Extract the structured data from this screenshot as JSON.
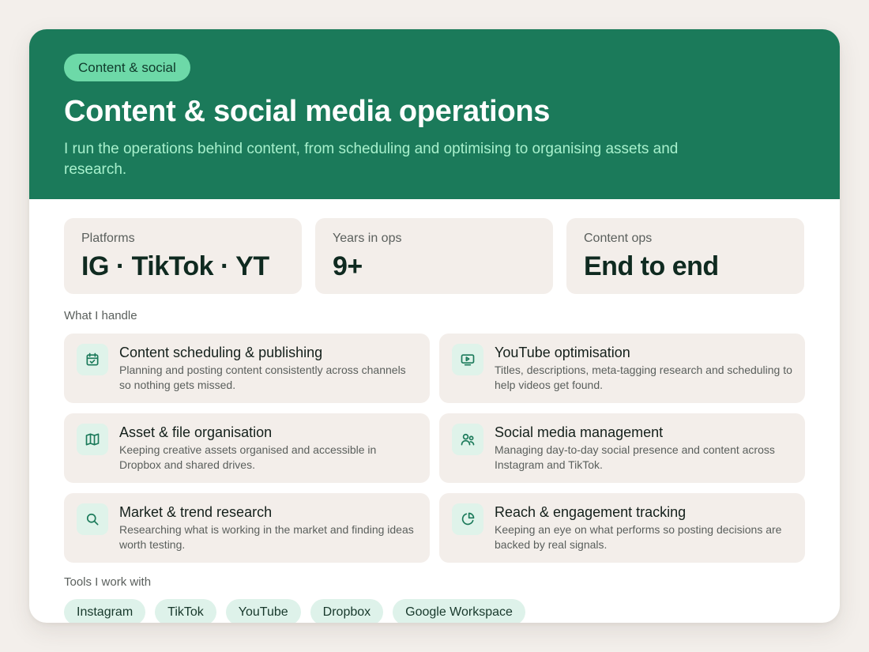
{
  "hero": {
    "badge": "Content & social",
    "title": "Content & social media operations",
    "subtitle": "I run the operations behind content, from scheduling and optimising to organising assets and research.",
    "color": "#1b7a5a"
  },
  "stats": [
    {
      "label": "Platforms",
      "value": "IG · TikTok · YT"
    },
    {
      "label": "Years in ops",
      "value": "9+"
    },
    {
      "label": "Content ops",
      "value": "End to end"
    }
  ],
  "handle": {
    "label": "What I handle",
    "items": [
      {
        "icon": "calendar-check-icon",
        "title": "Content scheduling & publishing",
        "desc": "Planning and posting content consistently across channels so nothing gets missed."
      },
      {
        "icon": "video-play-icon",
        "title": "YouTube optimisation",
        "desc": "Titles, descriptions, meta-tagging research and scheduling to help videos get found."
      },
      {
        "icon": "map-icon",
        "title": "Asset & file organisation",
        "desc": "Keeping creative assets organised and accessible in Dropbox and shared drives."
      },
      {
        "icon": "users-icon",
        "title": "Social media management",
        "desc": "Managing day-to-day social presence and content across Instagram and TikTok."
      },
      {
        "icon": "search-icon",
        "title": "Market & trend research",
        "desc": "Researching what is working in the market and finding ideas worth testing."
      },
      {
        "icon": "pie-chart-icon",
        "title": "Reach & engagement tracking",
        "desc": "Keeping an eye on what performs so posting decisions are backed by real signals."
      }
    ]
  },
  "tools": {
    "label": "Tools I work with",
    "items": [
      "Instagram",
      "TikTok",
      "YouTube",
      "Dropbox",
      "Google Workspace"
    ]
  },
  "colors": {
    "accent": "#1b7a5a",
    "icon_stroke": "#1b7a5a",
    "card_bg": "#f3eeea",
    "chip_bg": "#def2ea"
  }
}
